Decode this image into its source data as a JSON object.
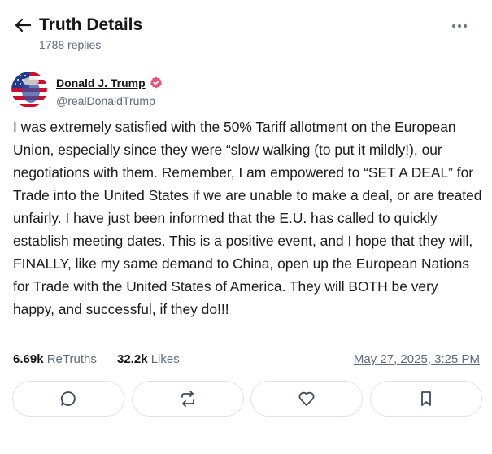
{
  "header": {
    "title": "Truth Details",
    "subtitle": "1788 replies"
  },
  "author": {
    "display_name": "Donald J. Trump",
    "handle": "@realDonaldTrump"
  },
  "post": {
    "text": "I was extremely satisfied with the 50% Tariff allotment on the European Union, especially since they were “slow walking (to put it mildly!), our negotiations with them. Remember, I am empowered to “SET A DEAL” for Trade into the United States if we are unable to make a deal, or are treated unfairly. I have just been informed that the E.U. has called to quickly establish meeting dates. This is a positive event, and I hope that they will, FINALLY, like my same demand to China, open up the European Nations for Trade with the United States of America. They will BOTH be very happy, and successful, if they do!!!"
  },
  "stats": {
    "retruths_count": "6.69k",
    "retruths_label": "ReTruths",
    "likes_count": "32.2k",
    "likes_label": "Likes",
    "timestamp": "May 27, 2025, 3:25 PM"
  },
  "colors": {
    "text_primary": "#161616",
    "text_secondary": "#5f6b78",
    "verified_badge": "#e8517a",
    "button_border": "#dfe3e8"
  },
  "icons": {
    "back": "arrow-left-icon",
    "more": "more-dots-icon",
    "verified": "verified-badge-icon",
    "reply": "reply-bubble-icon",
    "retruth": "retruth-arrows-icon",
    "like": "heart-icon",
    "bookmark": "bookmark-icon"
  }
}
